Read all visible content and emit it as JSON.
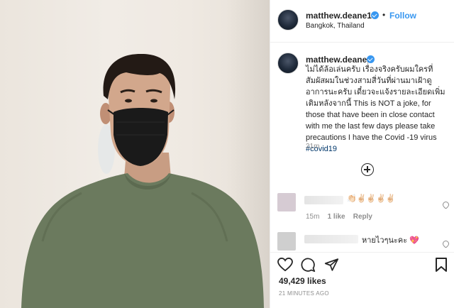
{
  "post": {
    "username": "matthew.deane1",
    "follow_label": "Follow",
    "separator": "•",
    "location": "Bangkok, Thailand",
    "caption_thai": "ไม่ได้ล้อเล่นครับ เรื่องจริงครับผมใครที่สัมผัสผมในช่วงสามสี่วันที่ผ่านมาเฝ้าดูอาการนะครับ เดี๋ยวจะแจ้งรายละเอียดเพิ่มเติมหลังจากนี้",
    "caption_english": "This is NOT a joke, for those that have been in close contact with me the last few days please take precautions I have the Covid -19 virus",
    "hashtag": "#covid19",
    "time_ago": "21m",
    "likes": "49,429 likes",
    "posted_ago": "21 MINUTES AGO"
  },
  "comments": [
    {
      "text": "👏🏻✌🏻✌🏻✌🏻✌🏻",
      "time": "15m",
      "likes": "1 like",
      "reply_label": "Reply"
    },
    {
      "text": "หายไวๆนะคะ 💖"
    }
  ],
  "icons": {
    "add_comment": "plus-circle-icon",
    "like": "heart-icon",
    "comment": "comment-icon",
    "share": "paper-plane-icon",
    "save": "bookmark-icon",
    "verified": "verified-badge-icon"
  },
  "colors": {
    "accent": "#3897f0",
    "hashtag": "#00376b",
    "muted": "#8e8e8e",
    "shirt": "#6b7a5e",
    "mask": "#1a1a1a"
  }
}
